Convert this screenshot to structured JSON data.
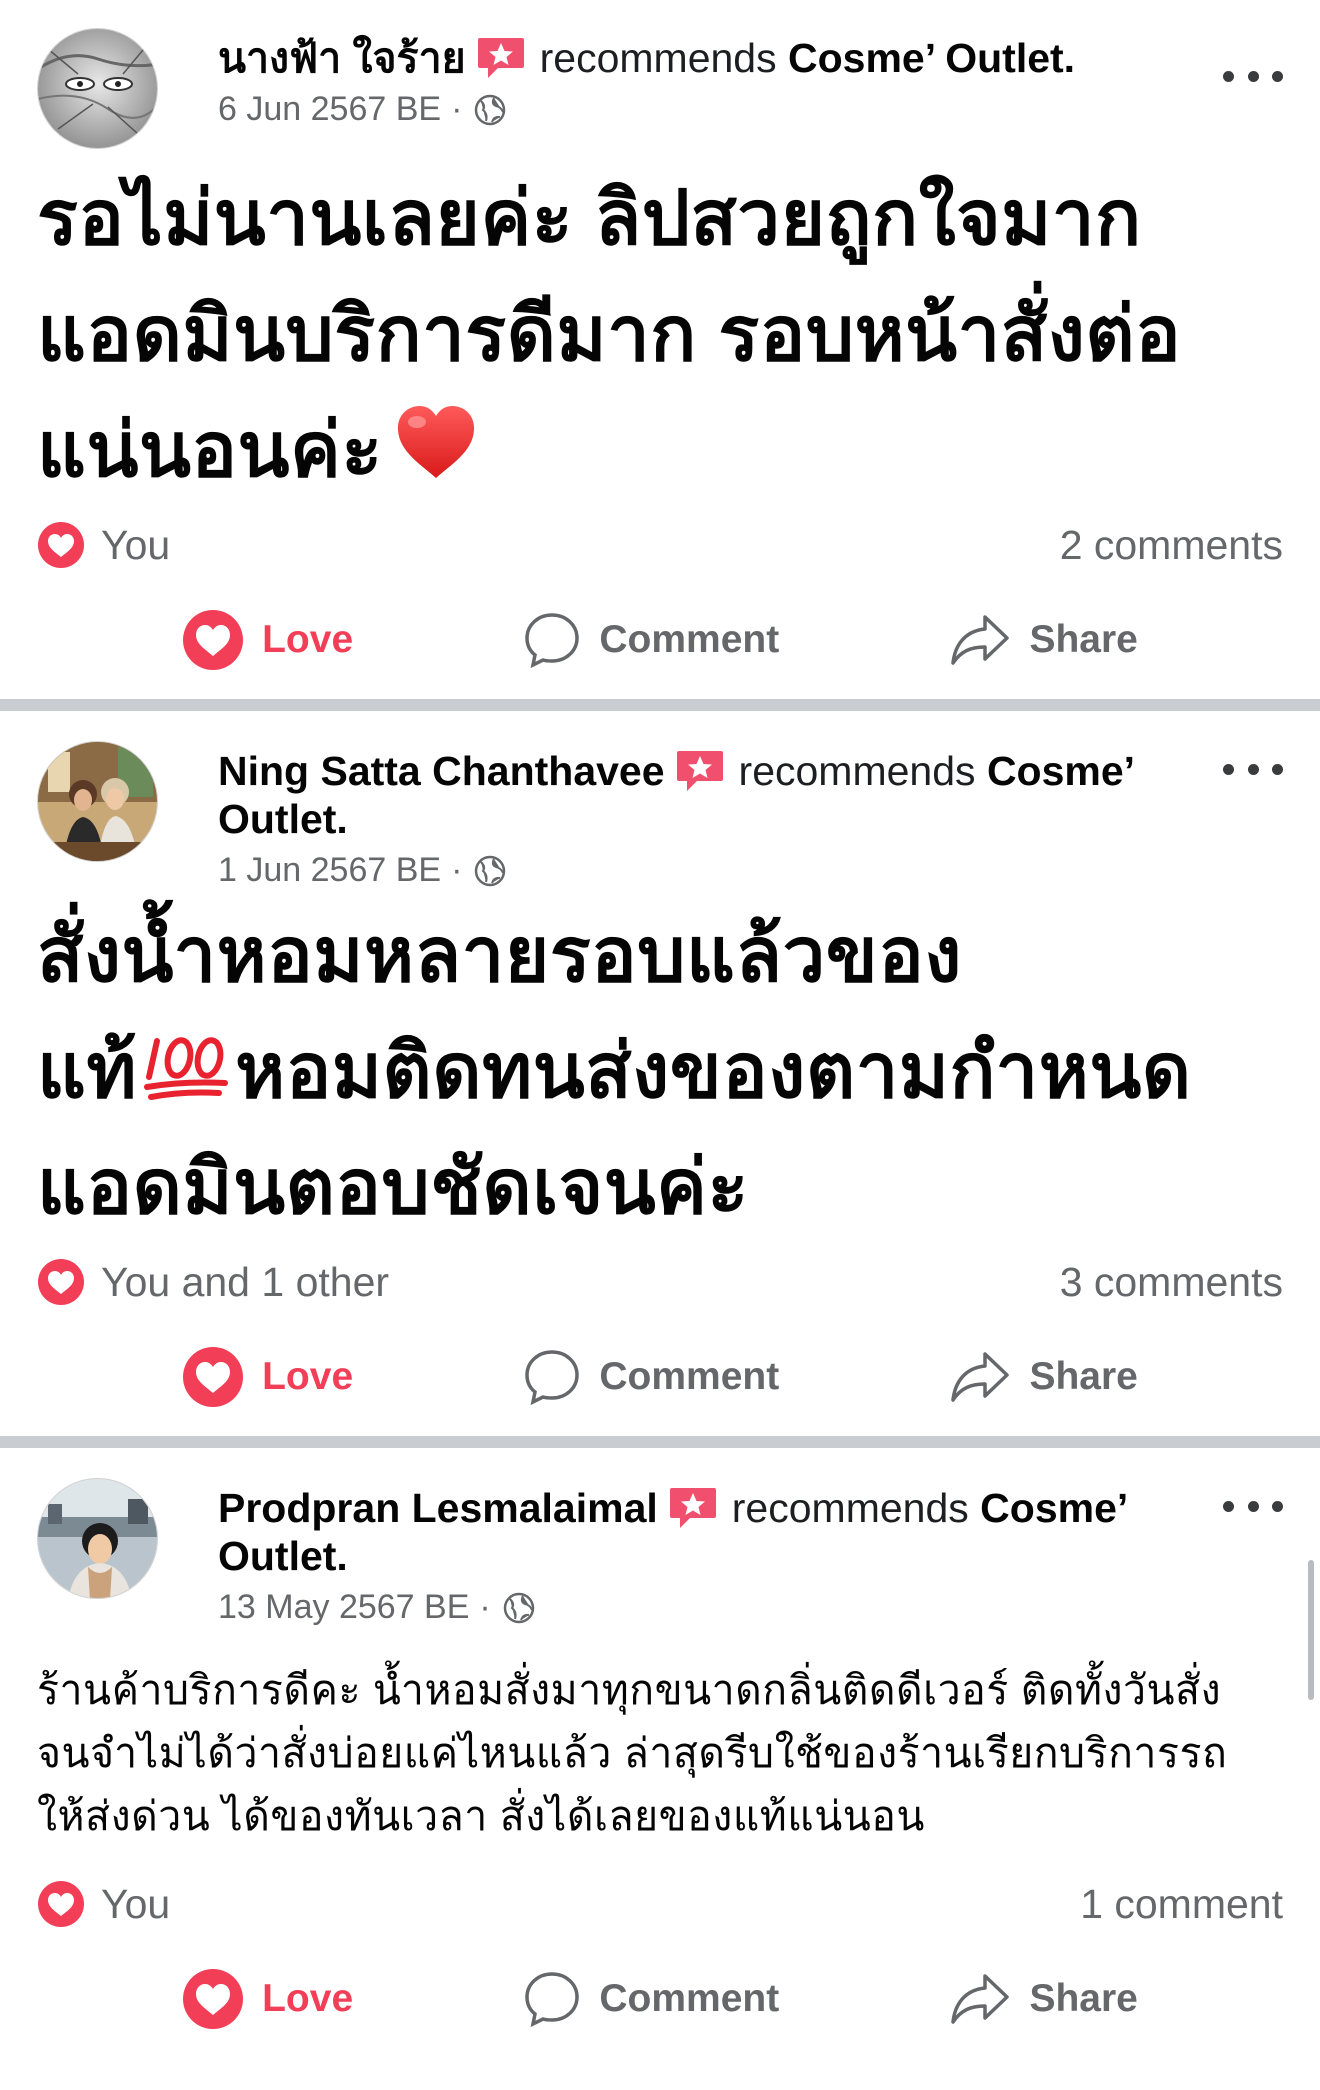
{
  "posts": [
    {
      "author": "นางฟ้า ใจร้าย",
      "recommends": "recommends",
      "page": "Cosme’ Outlet.",
      "date": "6 Jun 2567 BE",
      "dot": "·",
      "body_lines": [
        "รอไม่นานเลยค่ะ ลิปสวยถูกใจมาก",
        "แอดมินบริการดีมาก รอบหน้าสั่งต่อ",
        "แน่นอนค่ะ"
      ],
      "reaction_text": "You",
      "comments": "2 comments"
    },
    {
      "author": "Ning Satta Chanthavee",
      "recommends": "recommends",
      "page_line1": "Cosme’",
      "page_line2": "Outlet.",
      "date": "1 Jun 2567 BE",
      "dot": "·",
      "body_line1": "สั่งน้ำหอมหลายรอบแล้วของ",
      "body_line2a": "แท้",
      "body_line2b": "หอมติดทนส่งของตามกำหนด",
      "body_line3": "แอดมินตอบชัดเจนค่ะ",
      "reaction_text": "You and 1 other",
      "comments": "3 comments"
    },
    {
      "author": "Prodpran Lesmalaimal",
      "recommends": "recommends",
      "page_line1": "Cosme’",
      "page_line2": "Outlet.",
      "date": "13 May 2567 BE",
      "dot": "·",
      "body_lines": [
        "ร้านค้าบริการดีคะ น้ำหอมสั่งมาทุกขนาดกลิ่นติดดีเวอร์ ติดทั้งวันสั่ง",
        "จนจำไม่ได้ว่าสั่งบ่อยแค่ไหนแล้ว ล่าสุดรีบใช้ของร้านเรียกบริการรถ",
        "ให้ส่งด่วน ได้ของทันเวลา สั่งได้เลยของแท้แน่นอน"
      ],
      "reaction_text": "You",
      "comments": "1 comment"
    }
  ],
  "actions": {
    "love": "Love",
    "comment": "Comment",
    "share": "Share"
  },
  "colors": {
    "love": "#f33e58",
    "muted": "#65676b",
    "separator": "#c9ccd1"
  },
  "icons": [
    "recommend-star-icon",
    "globe-icon",
    "more-icon",
    "heart-reaction-icon",
    "love-icon",
    "comment-icon",
    "share-icon",
    "red-heart-emoji",
    "hundred-points-emoji"
  ]
}
